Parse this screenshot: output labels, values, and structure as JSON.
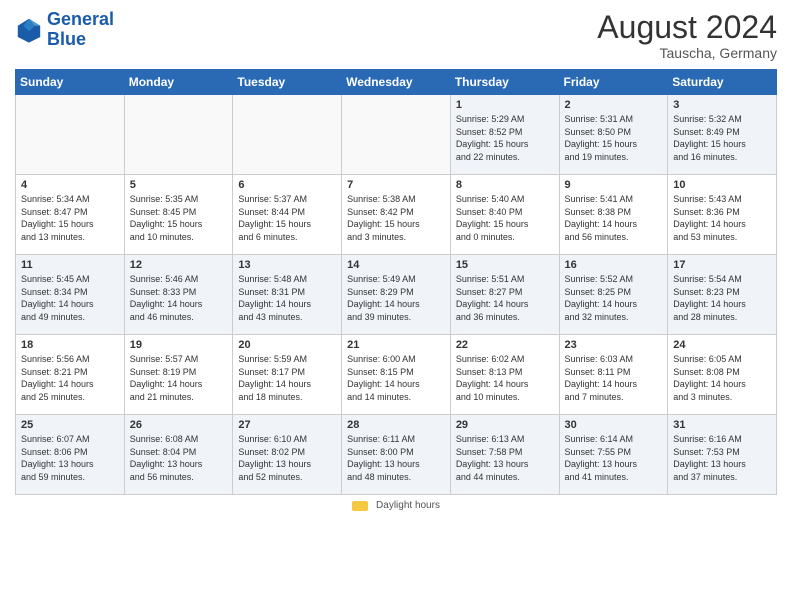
{
  "header": {
    "logo_line1": "General",
    "logo_line2": "Blue",
    "month_year": "August 2024",
    "location": "Tauscha, Germany"
  },
  "weekdays": [
    "Sunday",
    "Monday",
    "Tuesday",
    "Wednesday",
    "Thursday",
    "Friday",
    "Saturday"
  ],
  "weeks": [
    [
      {
        "day": "",
        "info": ""
      },
      {
        "day": "",
        "info": ""
      },
      {
        "day": "",
        "info": ""
      },
      {
        "day": "",
        "info": ""
      },
      {
        "day": "1",
        "info": "Sunrise: 5:29 AM\nSunset: 8:52 PM\nDaylight: 15 hours\nand 22 minutes."
      },
      {
        "day": "2",
        "info": "Sunrise: 5:31 AM\nSunset: 8:50 PM\nDaylight: 15 hours\nand 19 minutes."
      },
      {
        "day": "3",
        "info": "Sunrise: 5:32 AM\nSunset: 8:49 PM\nDaylight: 15 hours\nand 16 minutes."
      }
    ],
    [
      {
        "day": "4",
        "info": "Sunrise: 5:34 AM\nSunset: 8:47 PM\nDaylight: 15 hours\nand 13 minutes."
      },
      {
        "day": "5",
        "info": "Sunrise: 5:35 AM\nSunset: 8:45 PM\nDaylight: 15 hours\nand 10 minutes."
      },
      {
        "day": "6",
        "info": "Sunrise: 5:37 AM\nSunset: 8:44 PM\nDaylight: 15 hours\nand 6 minutes."
      },
      {
        "day": "7",
        "info": "Sunrise: 5:38 AM\nSunset: 8:42 PM\nDaylight: 15 hours\nand 3 minutes."
      },
      {
        "day": "8",
        "info": "Sunrise: 5:40 AM\nSunset: 8:40 PM\nDaylight: 15 hours\nand 0 minutes."
      },
      {
        "day": "9",
        "info": "Sunrise: 5:41 AM\nSunset: 8:38 PM\nDaylight: 14 hours\nand 56 minutes."
      },
      {
        "day": "10",
        "info": "Sunrise: 5:43 AM\nSunset: 8:36 PM\nDaylight: 14 hours\nand 53 minutes."
      }
    ],
    [
      {
        "day": "11",
        "info": "Sunrise: 5:45 AM\nSunset: 8:34 PM\nDaylight: 14 hours\nand 49 minutes."
      },
      {
        "day": "12",
        "info": "Sunrise: 5:46 AM\nSunset: 8:33 PM\nDaylight: 14 hours\nand 46 minutes."
      },
      {
        "day": "13",
        "info": "Sunrise: 5:48 AM\nSunset: 8:31 PM\nDaylight: 14 hours\nand 43 minutes."
      },
      {
        "day": "14",
        "info": "Sunrise: 5:49 AM\nSunset: 8:29 PM\nDaylight: 14 hours\nand 39 minutes."
      },
      {
        "day": "15",
        "info": "Sunrise: 5:51 AM\nSunset: 8:27 PM\nDaylight: 14 hours\nand 36 minutes."
      },
      {
        "day": "16",
        "info": "Sunrise: 5:52 AM\nSunset: 8:25 PM\nDaylight: 14 hours\nand 32 minutes."
      },
      {
        "day": "17",
        "info": "Sunrise: 5:54 AM\nSunset: 8:23 PM\nDaylight: 14 hours\nand 28 minutes."
      }
    ],
    [
      {
        "day": "18",
        "info": "Sunrise: 5:56 AM\nSunset: 8:21 PM\nDaylight: 14 hours\nand 25 minutes."
      },
      {
        "day": "19",
        "info": "Sunrise: 5:57 AM\nSunset: 8:19 PM\nDaylight: 14 hours\nand 21 minutes."
      },
      {
        "day": "20",
        "info": "Sunrise: 5:59 AM\nSunset: 8:17 PM\nDaylight: 14 hours\nand 18 minutes."
      },
      {
        "day": "21",
        "info": "Sunrise: 6:00 AM\nSunset: 8:15 PM\nDaylight: 14 hours\nand 14 minutes."
      },
      {
        "day": "22",
        "info": "Sunrise: 6:02 AM\nSunset: 8:13 PM\nDaylight: 14 hours\nand 10 minutes."
      },
      {
        "day": "23",
        "info": "Sunrise: 6:03 AM\nSunset: 8:11 PM\nDaylight: 14 hours\nand 7 minutes."
      },
      {
        "day": "24",
        "info": "Sunrise: 6:05 AM\nSunset: 8:08 PM\nDaylight: 14 hours\nand 3 minutes."
      }
    ],
    [
      {
        "day": "25",
        "info": "Sunrise: 6:07 AM\nSunset: 8:06 PM\nDaylight: 13 hours\nand 59 minutes."
      },
      {
        "day": "26",
        "info": "Sunrise: 6:08 AM\nSunset: 8:04 PM\nDaylight: 13 hours\nand 56 minutes."
      },
      {
        "day": "27",
        "info": "Sunrise: 6:10 AM\nSunset: 8:02 PM\nDaylight: 13 hours\nand 52 minutes."
      },
      {
        "day": "28",
        "info": "Sunrise: 6:11 AM\nSunset: 8:00 PM\nDaylight: 13 hours\nand 48 minutes."
      },
      {
        "day": "29",
        "info": "Sunrise: 6:13 AM\nSunset: 7:58 PM\nDaylight: 13 hours\nand 44 minutes."
      },
      {
        "day": "30",
        "info": "Sunrise: 6:14 AM\nSunset: 7:55 PM\nDaylight: 13 hours\nand 41 minutes."
      },
      {
        "day": "31",
        "info": "Sunrise: 6:16 AM\nSunset: 7:53 PM\nDaylight: 13 hours\nand 37 minutes."
      }
    ]
  ],
  "legend": {
    "label": "Daylight hours"
  }
}
